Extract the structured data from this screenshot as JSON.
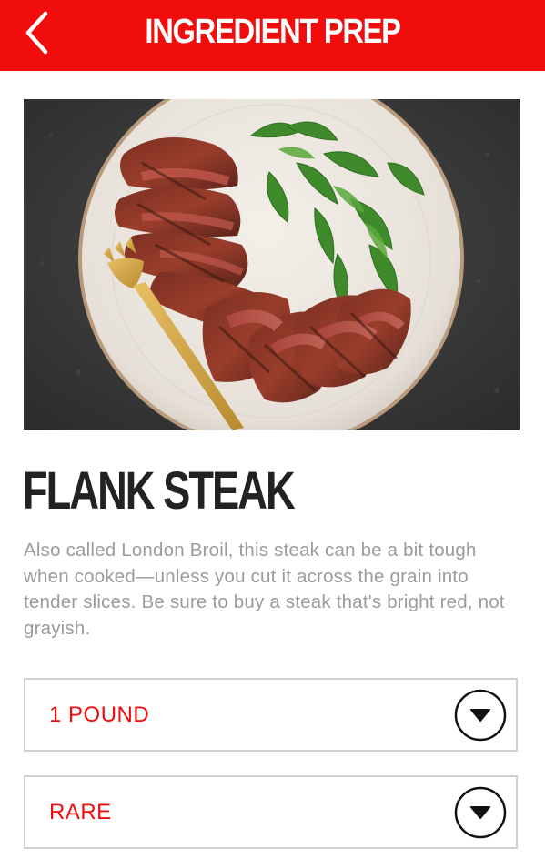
{
  "header": {
    "title": "INGREDIENT PREP",
    "back_icon": "chevron-left-icon"
  },
  "ingredient": {
    "title": "FLANK STEAK",
    "description": "Also called London Broil, this steak can be a bit tough when cooked—unless you cut it across the grain into tender slices. Be sure to buy a steak that's bright red, not grayish."
  },
  "options": [
    {
      "selected": "1 POUND",
      "icon": "chevron-down-circle-icon"
    },
    {
      "selected": "RARE",
      "icon": "chevron-down-circle-icon"
    }
  ],
  "colors": {
    "accent": "#f20d0d",
    "title_text": "#222222",
    "body_text": "#9b9b9b",
    "border": "#cfcfcf"
  }
}
